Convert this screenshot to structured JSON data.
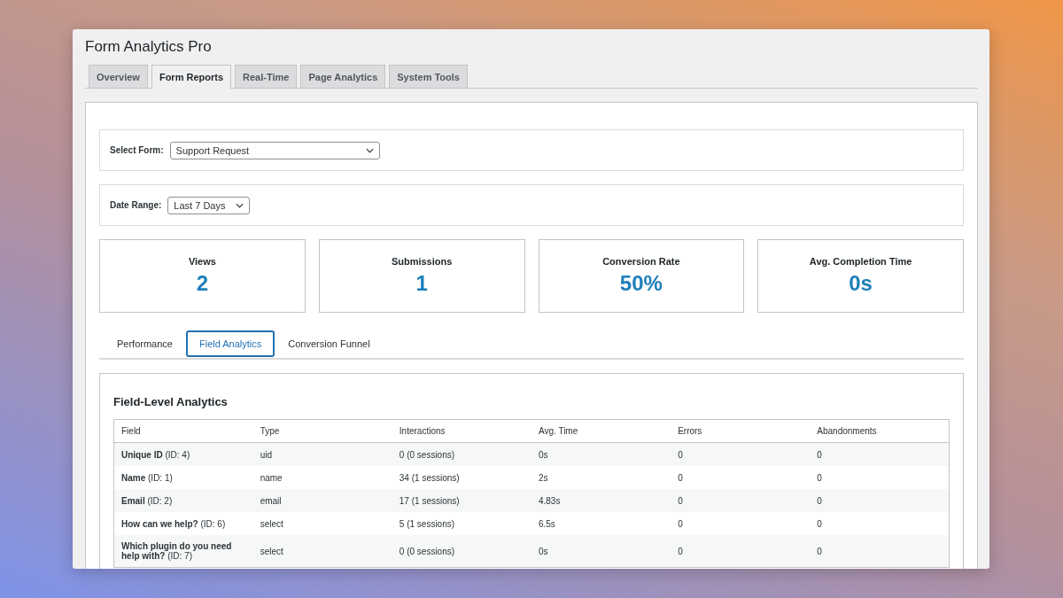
{
  "window": {
    "title": "Form Analytics Pro"
  },
  "tabs": [
    {
      "label": "Overview",
      "selected": false
    },
    {
      "label": "Form Reports",
      "selected": true
    },
    {
      "label": "Real-Time",
      "selected": false
    },
    {
      "label": "Page Analytics",
      "selected": false
    },
    {
      "label": "System Tools",
      "selected": false
    }
  ],
  "form_select": {
    "label": "Select Form:",
    "value": "Support Request"
  },
  "date_range": {
    "label": "Date Range:",
    "value": "Last 7 Days"
  },
  "stats": [
    {
      "label": "Views",
      "value": "2"
    },
    {
      "label": "Submissions",
      "value": "1"
    },
    {
      "label": "Conversion Rate",
      "value": "50%"
    },
    {
      "label": "Avg. Completion Time",
      "value": "0s"
    }
  ],
  "subtabs": [
    {
      "label": "Performance",
      "selected": false
    },
    {
      "label": "Field Analytics",
      "selected": true
    },
    {
      "label": "Conversion Funnel",
      "selected": false
    }
  ],
  "section_title": "Field-Level Analytics",
  "table": {
    "columns": [
      "Field",
      "Type",
      "Interactions",
      "Avg. Time",
      "Errors",
      "Abandonments"
    ],
    "rows": [
      [
        "**Unique ID** (ID: 4)",
        "uid",
        "0 (0 sessions)",
        "0s",
        "0",
        "0"
      ],
      [
        "**Name** (ID: 1)",
        "name",
        "34 (1 sessions)",
        "2s",
        "0",
        "0"
      ],
      [
        "**Email** (ID: 2)",
        "email",
        "17 (1 sessions)",
        "4.83s",
        "0",
        "0"
      ],
      [
        "**How can we help?** (ID: 6)",
        "select",
        "5 (1 sessions)",
        "6.5s",
        "0",
        "0"
      ],
      [
        "**Which plugin do you need help with?** (ID: 7)",
        "select",
        "0 (0 sessions)",
        "0s",
        "0",
        "0"
      ]
    ]
  }
}
